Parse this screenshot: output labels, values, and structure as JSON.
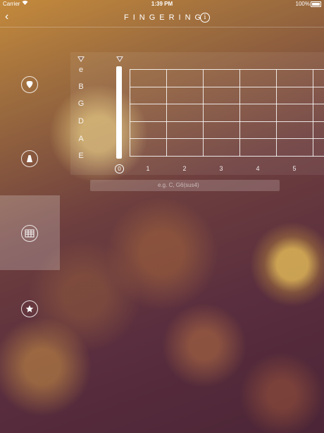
{
  "status": {
    "carrier": "Carrier",
    "time": "1:39 PM",
    "battery": "100%"
  },
  "nav": {
    "title": "FINGERING",
    "info_label": "i"
  },
  "sidebar": [
    "pick-icon",
    "metronome-icon",
    "chord-chart-icon",
    "star-icon"
  ],
  "strings": [
    "e",
    "B",
    "G",
    "D",
    "A",
    "E"
  ],
  "frets": [
    "1",
    "2",
    "3",
    "4",
    "5"
  ],
  "open_fret": "0",
  "search": {
    "placeholder": "e.g.   C, G6(sus4)"
  }
}
